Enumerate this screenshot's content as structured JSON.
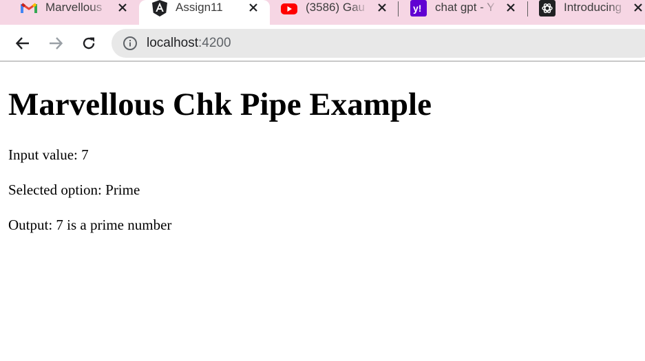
{
  "tabs": [
    {
      "favicon": "gmail-icon",
      "title": "Marvellous",
      "active": false
    },
    {
      "favicon": "angular-icon",
      "title": "Assign11",
      "active": true
    },
    {
      "favicon": "youtube-icon",
      "title": "(3586) Gau",
      "active": false
    },
    {
      "favicon": "yahoo-icon",
      "title": "chat gpt - Y",
      "active": false
    },
    {
      "favicon": "openai-icon",
      "title": "Introducing",
      "active": false
    }
  ],
  "toolbar": {
    "back_icon": "arrow-left-icon",
    "forward_icon": "arrow-right-icon",
    "reload_icon": "reload-icon",
    "site_info_icon": "info-icon",
    "url_host": "localhost",
    "url_port": ":4200"
  },
  "page": {
    "heading": "Marvellous Chk Pipe Example",
    "input_line": "Input value: 7",
    "option_line": "Selected option: Prime",
    "output_line": "Output: 7 is a prime number"
  },
  "colors": {
    "tabstrip_bg": "#f6d6e4",
    "omnibox_bg": "#e8e8e8",
    "youtube_red": "#ff0000",
    "yahoo_purple": "#6001d2",
    "angular_dark": "#202124"
  }
}
